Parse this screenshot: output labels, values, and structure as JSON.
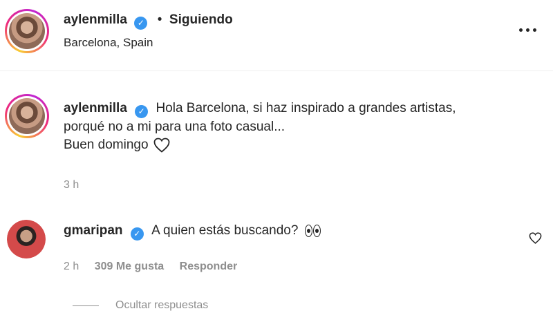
{
  "post": {
    "author": "aylenmilla",
    "follow_status": "Siguiendo",
    "location": "Barcelona, Spain",
    "more_icon": "more-options-icon"
  },
  "caption": {
    "author": "aylenmilla",
    "text_line1": "Hola Barcelona, si haz inspirado a grandes artistas,",
    "text_line2": "porqué no a mi para una foto casual...",
    "text_line3": "Buen domingo",
    "heart_icon": "heart-outline-icon",
    "time": "3 h"
  },
  "comments": [
    {
      "author": "gmaripan",
      "text": "A quien estás buscando?",
      "emoji": "eyes-emoji",
      "time": "2 h",
      "likes": "309 Me gusta",
      "reply": "Responder",
      "like_icon": "heart-outline-icon"
    }
  ],
  "replies_toggle": "Ocultar respuestas",
  "colors": {
    "text": "#262626",
    "muted": "#8e8e8e",
    "verified": "#3897f0"
  }
}
